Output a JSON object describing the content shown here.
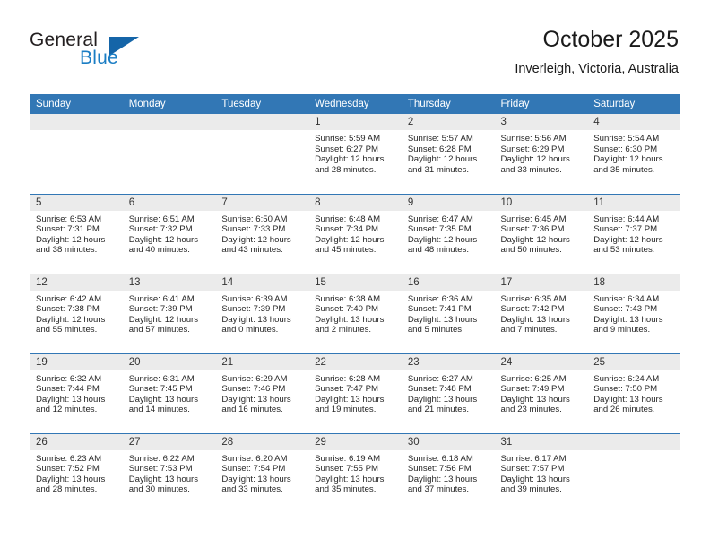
{
  "brand": {
    "name_top": "General",
    "name_bottom": "Blue",
    "triangle_color": "#1565a8",
    "blue_color": "#1a7dc4"
  },
  "header": {
    "title": "October 2025",
    "subtitle": "Inverleigh, Victoria, Australia"
  },
  "theme": {
    "header_row_bg": "#3277b5",
    "daynum_bg": "#ebebeb",
    "grid_line": "#3277b5"
  },
  "weekdays": [
    "Sunday",
    "Monday",
    "Tuesday",
    "Wednesday",
    "Thursday",
    "Friday",
    "Saturday"
  ],
  "labels": {
    "sunrise": "Sunrise:",
    "sunset": "Sunset:",
    "daylight": "Daylight:"
  },
  "weeks": [
    [
      {
        "day": "",
        "sunrise": "",
        "sunset": "",
        "daylight_line1": "",
        "daylight_line2": ""
      },
      {
        "day": "",
        "sunrise": "",
        "sunset": "",
        "daylight_line1": "",
        "daylight_line2": ""
      },
      {
        "day": "",
        "sunrise": "",
        "sunset": "",
        "daylight_line1": "",
        "daylight_line2": ""
      },
      {
        "day": "1",
        "sunrise": "Sunrise: 5:59 AM",
        "sunset": "Sunset: 6:27 PM",
        "daylight_line1": "Daylight: 12 hours",
        "daylight_line2": "and 28 minutes."
      },
      {
        "day": "2",
        "sunrise": "Sunrise: 5:57 AM",
        "sunset": "Sunset: 6:28 PM",
        "daylight_line1": "Daylight: 12 hours",
        "daylight_line2": "and 31 minutes."
      },
      {
        "day": "3",
        "sunrise": "Sunrise: 5:56 AM",
        "sunset": "Sunset: 6:29 PM",
        "daylight_line1": "Daylight: 12 hours",
        "daylight_line2": "and 33 minutes."
      },
      {
        "day": "4",
        "sunrise": "Sunrise: 5:54 AM",
        "sunset": "Sunset: 6:30 PM",
        "daylight_line1": "Daylight: 12 hours",
        "daylight_line2": "and 35 minutes."
      }
    ],
    [
      {
        "day": "5",
        "sunrise": "Sunrise: 6:53 AM",
        "sunset": "Sunset: 7:31 PM",
        "daylight_line1": "Daylight: 12 hours",
        "daylight_line2": "and 38 minutes."
      },
      {
        "day": "6",
        "sunrise": "Sunrise: 6:51 AM",
        "sunset": "Sunset: 7:32 PM",
        "daylight_line1": "Daylight: 12 hours",
        "daylight_line2": "and 40 minutes."
      },
      {
        "day": "7",
        "sunrise": "Sunrise: 6:50 AM",
        "sunset": "Sunset: 7:33 PM",
        "daylight_line1": "Daylight: 12 hours",
        "daylight_line2": "and 43 minutes."
      },
      {
        "day": "8",
        "sunrise": "Sunrise: 6:48 AM",
        "sunset": "Sunset: 7:34 PM",
        "daylight_line1": "Daylight: 12 hours",
        "daylight_line2": "and 45 minutes."
      },
      {
        "day": "9",
        "sunrise": "Sunrise: 6:47 AM",
        "sunset": "Sunset: 7:35 PM",
        "daylight_line1": "Daylight: 12 hours",
        "daylight_line2": "and 48 minutes."
      },
      {
        "day": "10",
        "sunrise": "Sunrise: 6:45 AM",
        "sunset": "Sunset: 7:36 PM",
        "daylight_line1": "Daylight: 12 hours",
        "daylight_line2": "and 50 minutes."
      },
      {
        "day": "11",
        "sunrise": "Sunrise: 6:44 AM",
        "sunset": "Sunset: 7:37 PM",
        "daylight_line1": "Daylight: 12 hours",
        "daylight_line2": "and 53 minutes."
      }
    ],
    [
      {
        "day": "12",
        "sunrise": "Sunrise: 6:42 AM",
        "sunset": "Sunset: 7:38 PM",
        "daylight_line1": "Daylight: 12 hours",
        "daylight_line2": "and 55 minutes."
      },
      {
        "day": "13",
        "sunrise": "Sunrise: 6:41 AM",
        "sunset": "Sunset: 7:39 PM",
        "daylight_line1": "Daylight: 12 hours",
        "daylight_line2": "and 57 minutes."
      },
      {
        "day": "14",
        "sunrise": "Sunrise: 6:39 AM",
        "sunset": "Sunset: 7:39 PM",
        "daylight_line1": "Daylight: 13 hours",
        "daylight_line2": "and 0 minutes."
      },
      {
        "day": "15",
        "sunrise": "Sunrise: 6:38 AM",
        "sunset": "Sunset: 7:40 PM",
        "daylight_line1": "Daylight: 13 hours",
        "daylight_line2": "and 2 minutes."
      },
      {
        "day": "16",
        "sunrise": "Sunrise: 6:36 AM",
        "sunset": "Sunset: 7:41 PM",
        "daylight_line1": "Daylight: 13 hours",
        "daylight_line2": "and 5 minutes."
      },
      {
        "day": "17",
        "sunrise": "Sunrise: 6:35 AM",
        "sunset": "Sunset: 7:42 PM",
        "daylight_line1": "Daylight: 13 hours",
        "daylight_line2": "and 7 minutes."
      },
      {
        "day": "18",
        "sunrise": "Sunrise: 6:34 AM",
        "sunset": "Sunset: 7:43 PM",
        "daylight_line1": "Daylight: 13 hours",
        "daylight_line2": "and 9 minutes."
      }
    ],
    [
      {
        "day": "19",
        "sunrise": "Sunrise: 6:32 AM",
        "sunset": "Sunset: 7:44 PM",
        "daylight_line1": "Daylight: 13 hours",
        "daylight_line2": "and 12 minutes."
      },
      {
        "day": "20",
        "sunrise": "Sunrise: 6:31 AM",
        "sunset": "Sunset: 7:45 PM",
        "daylight_line1": "Daylight: 13 hours",
        "daylight_line2": "and 14 minutes."
      },
      {
        "day": "21",
        "sunrise": "Sunrise: 6:29 AM",
        "sunset": "Sunset: 7:46 PM",
        "daylight_line1": "Daylight: 13 hours",
        "daylight_line2": "and 16 minutes."
      },
      {
        "day": "22",
        "sunrise": "Sunrise: 6:28 AM",
        "sunset": "Sunset: 7:47 PM",
        "daylight_line1": "Daylight: 13 hours",
        "daylight_line2": "and 19 minutes."
      },
      {
        "day": "23",
        "sunrise": "Sunrise: 6:27 AM",
        "sunset": "Sunset: 7:48 PM",
        "daylight_line1": "Daylight: 13 hours",
        "daylight_line2": "and 21 minutes."
      },
      {
        "day": "24",
        "sunrise": "Sunrise: 6:25 AM",
        "sunset": "Sunset: 7:49 PM",
        "daylight_line1": "Daylight: 13 hours",
        "daylight_line2": "and 23 minutes."
      },
      {
        "day": "25",
        "sunrise": "Sunrise: 6:24 AM",
        "sunset": "Sunset: 7:50 PM",
        "daylight_line1": "Daylight: 13 hours",
        "daylight_line2": "and 26 minutes."
      }
    ],
    [
      {
        "day": "26",
        "sunrise": "Sunrise: 6:23 AM",
        "sunset": "Sunset: 7:52 PM",
        "daylight_line1": "Daylight: 13 hours",
        "daylight_line2": "and 28 minutes."
      },
      {
        "day": "27",
        "sunrise": "Sunrise: 6:22 AM",
        "sunset": "Sunset: 7:53 PM",
        "daylight_line1": "Daylight: 13 hours",
        "daylight_line2": "and 30 minutes."
      },
      {
        "day": "28",
        "sunrise": "Sunrise: 6:20 AM",
        "sunset": "Sunset: 7:54 PM",
        "daylight_line1": "Daylight: 13 hours",
        "daylight_line2": "and 33 minutes."
      },
      {
        "day": "29",
        "sunrise": "Sunrise: 6:19 AM",
        "sunset": "Sunset: 7:55 PM",
        "daylight_line1": "Daylight: 13 hours",
        "daylight_line2": "and 35 minutes."
      },
      {
        "day": "30",
        "sunrise": "Sunrise: 6:18 AM",
        "sunset": "Sunset: 7:56 PM",
        "daylight_line1": "Daylight: 13 hours",
        "daylight_line2": "and 37 minutes."
      },
      {
        "day": "31",
        "sunrise": "Sunrise: 6:17 AM",
        "sunset": "Sunset: 7:57 PM",
        "daylight_line1": "Daylight: 13 hours",
        "daylight_line2": "and 39 minutes."
      },
      {
        "day": "",
        "sunrise": "",
        "sunset": "",
        "daylight_line1": "",
        "daylight_line2": ""
      }
    ]
  ]
}
